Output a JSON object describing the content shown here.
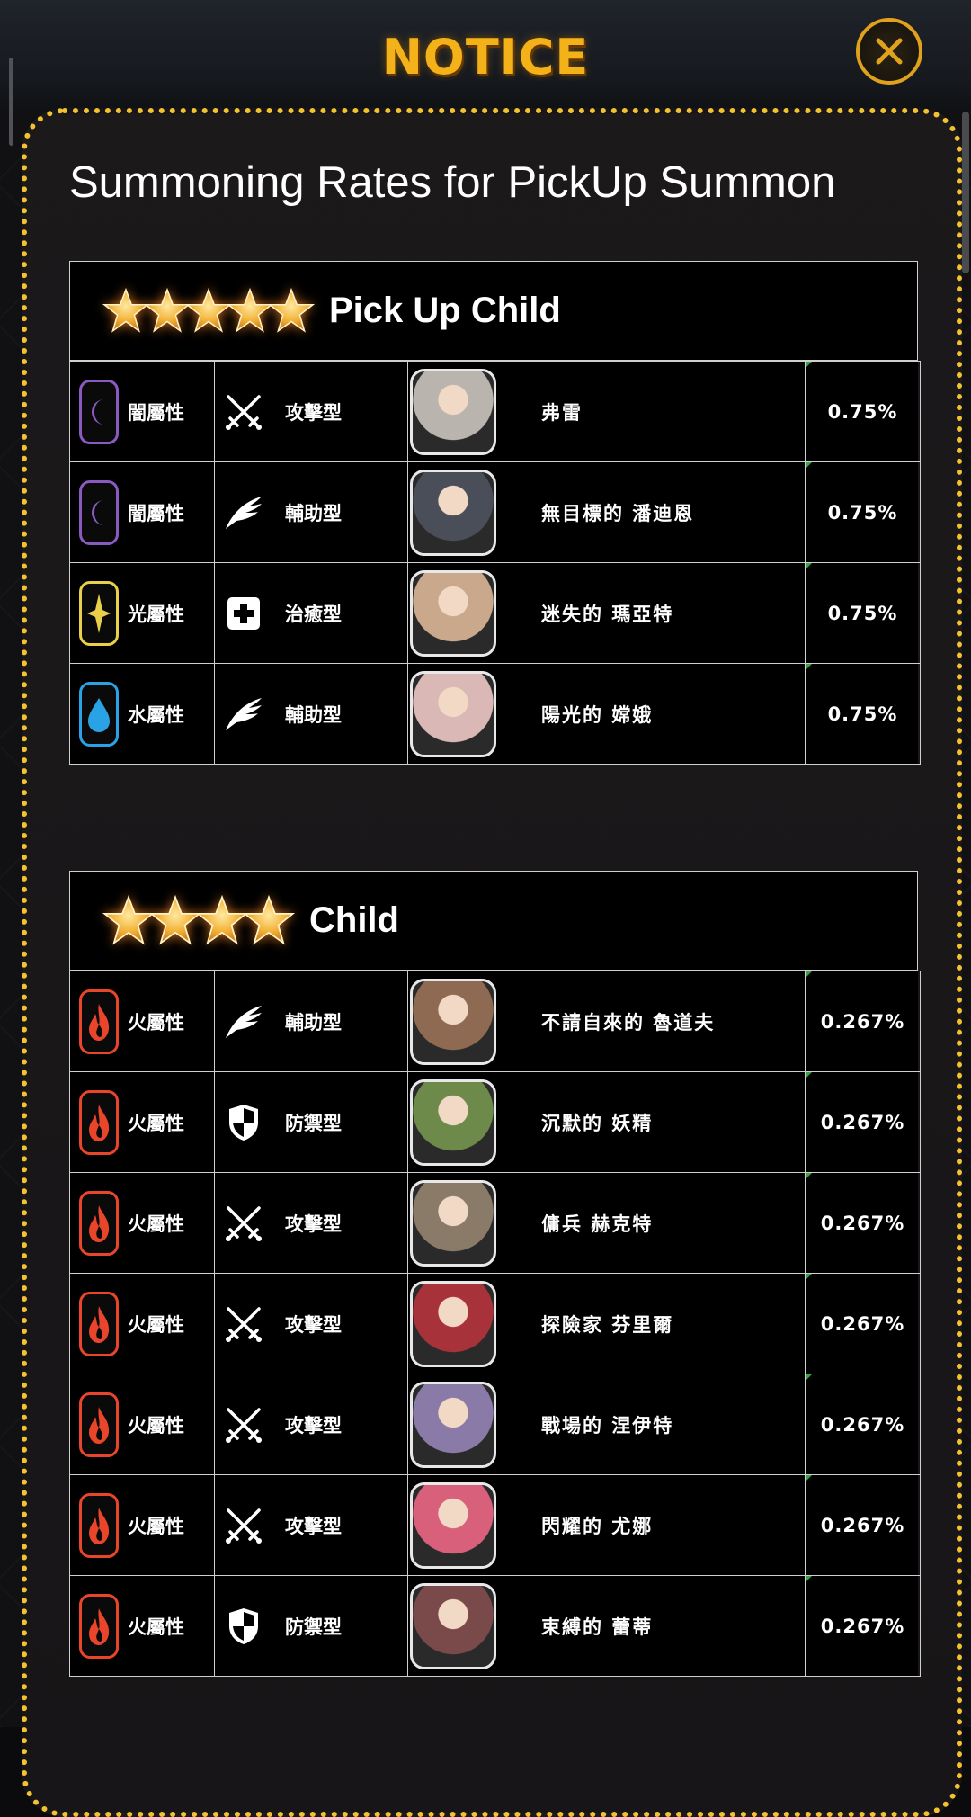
{
  "header": {
    "title": "NOTICE"
  },
  "page": {
    "title": "Summoning Rates for PickUp Summon"
  },
  "sections": [
    {
      "title": "Pick Up Child",
      "stars": 5,
      "rows": [
        {
          "attribute": "闇屬性",
          "attribute_icon": "moon-icon",
          "attribute_color": "#8a5ac0",
          "type": "攻擊型",
          "type_icon": "crossed-swords-icon",
          "name": "弗雷",
          "rate": "0.75%",
          "portrait_color": "#b9b4ae"
        },
        {
          "attribute": "闇屬性",
          "attribute_icon": "moon-icon",
          "attribute_color": "#8a5ac0",
          "type": "輔助型",
          "type_icon": "wing-icon",
          "name": "無目標的 潘迪恩",
          "rate": "0.75%",
          "portrait_color": "#4a4e58"
        },
        {
          "attribute": "光屬性",
          "attribute_icon": "sparkle-icon",
          "attribute_color": "#e8d04a",
          "type": "治癒型",
          "type_icon": "medical-cross-icon",
          "name": "迷失的 瑪亞特",
          "rate": "0.75%",
          "portrait_color": "#c9a88c"
        },
        {
          "attribute": "水屬性",
          "attribute_icon": "water-drop-icon",
          "attribute_color": "#2aa3e6",
          "type": "輔助型",
          "type_icon": "wing-icon",
          "name": "陽光的 嫦娥",
          "rate": "0.75%",
          "portrait_color": "#d9b8b6"
        }
      ]
    },
    {
      "title": "Child",
      "stars": 4,
      "rows": [
        {
          "attribute": "火屬性",
          "attribute_icon": "flame-icon",
          "attribute_color": "#e8452a",
          "type": "輔助型",
          "type_icon": "wing-icon",
          "name": "不請自來的 魯道夫",
          "rate": "0.267%",
          "portrait_color": "#8e6a52"
        },
        {
          "attribute": "火屬性",
          "attribute_icon": "flame-icon",
          "attribute_color": "#e8452a",
          "type": "防禦型",
          "type_icon": "shield-icon",
          "name": "沉默的 妖精",
          "rate": "0.267%",
          "portrait_color": "#6e8a4a"
        },
        {
          "attribute": "火屬性",
          "attribute_icon": "flame-icon",
          "attribute_color": "#e8452a",
          "type": "攻擊型",
          "type_icon": "crossed-swords-icon",
          "name": "傭兵 赫克特",
          "rate": "0.267%",
          "portrait_color": "#8a7a68"
        },
        {
          "attribute": "火屬性",
          "attribute_icon": "flame-icon",
          "attribute_color": "#e8452a",
          "type": "攻擊型",
          "type_icon": "crossed-swords-icon",
          "name": "探險家 芬里爾",
          "rate": "0.267%",
          "portrait_color": "#a8323a"
        },
        {
          "attribute": "火屬性",
          "attribute_icon": "flame-icon",
          "attribute_color": "#e8452a",
          "type": "攻擊型",
          "type_icon": "crossed-swords-icon",
          "name": "戰場的 涅伊特",
          "rate": "0.267%",
          "portrait_color": "#8a7aa8"
        },
        {
          "attribute": "火屬性",
          "attribute_icon": "flame-icon",
          "attribute_color": "#e8452a",
          "type": "攻擊型",
          "type_icon": "crossed-swords-icon",
          "name": "閃耀的 尤娜",
          "rate": "0.267%",
          "portrait_color": "#d8607a"
        },
        {
          "attribute": "火屬性",
          "attribute_icon": "flame-icon",
          "attribute_color": "#e8452a",
          "type": "防禦型",
          "type_icon": "shield-icon",
          "name": "束縛的 蕾蒂",
          "rate": "0.267%",
          "portrait_color": "#7a4a4a"
        }
      ]
    }
  ]
}
